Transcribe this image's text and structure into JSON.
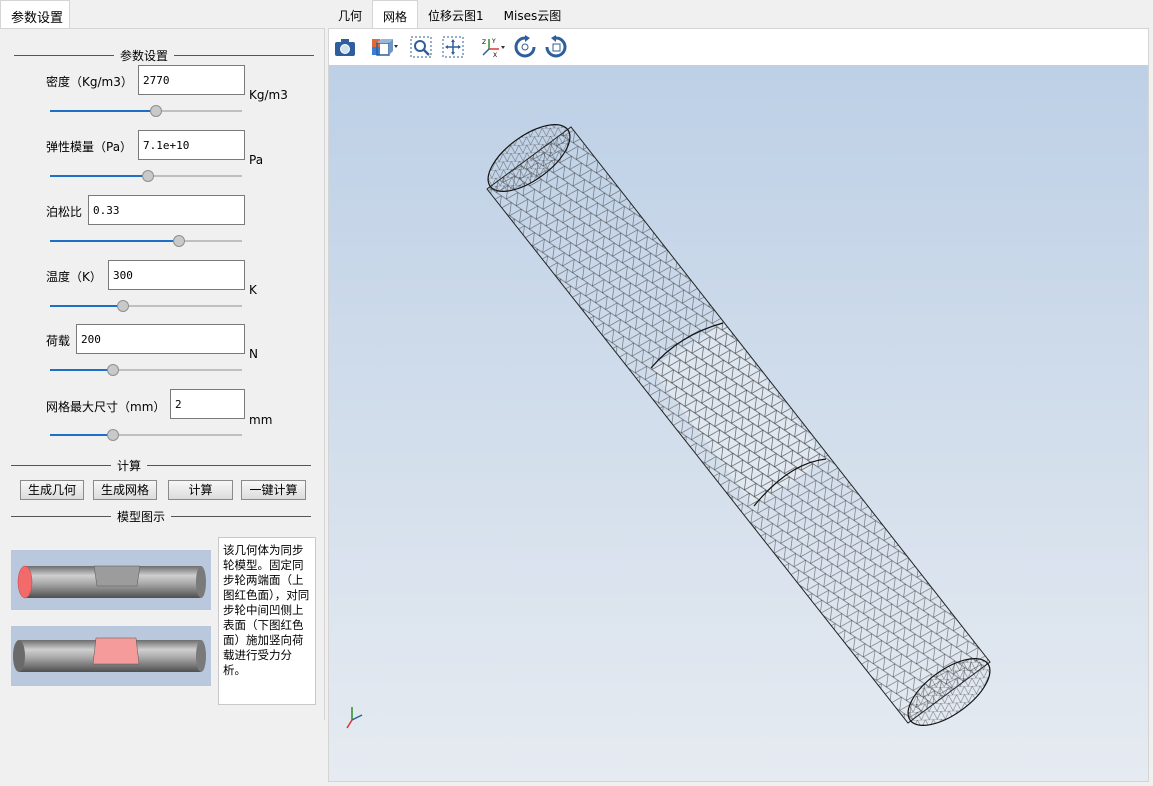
{
  "left_tab": {
    "label": "参数设置"
  },
  "params_group": {
    "title": "参数设置"
  },
  "params": [
    {
      "label": "密度（Kg/m3）",
      "value": "2770",
      "unit": "Kg/m3",
      "slider": 0.55
    },
    {
      "label": "弹性模量（Pa）",
      "value": "7.1e+10",
      "unit": "Pa",
      "slider": 0.51
    },
    {
      "label": "泊松比",
      "value": "0.33",
      "unit": "",
      "slider": 0.67
    },
    {
      "label": "温度（K）",
      "value": "300",
      "unit": "K",
      "slider": 0.38
    },
    {
      "label": "荷载",
      "value": "200",
      "unit": "N",
      "slider": 0.33
    },
    {
      "label": "网格最大尺寸（mm）",
      "value": "2",
      "unit": "mm",
      "slider": 0.33
    }
  ],
  "compute_group": {
    "title": "计算"
  },
  "buttons": {
    "gen_geometry": "生成几何",
    "gen_mesh": "生成网格",
    "compute": "计算",
    "one_click": "一键计算"
  },
  "model_group": {
    "title": "模型图示"
  },
  "description": "该几何体为同步轮模型。固定同步轮两端面（上图红色面），对同步轮中间凹侧上表面（下图红色面）施加竖向荷载进行受力分析。",
  "tabs": [
    "几何",
    "网格",
    "位移云图1",
    "Mises云图"
  ],
  "active_tab": 1,
  "toolbar_icons": [
    "camera-icon",
    "view-cube-icon",
    "zoom-fit-icon",
    "pan-icon",
    "axes-orient-icon",
    "rotate-cw-icon",
    "rotate-ccw-icon"
  ],
  "colors": {
    "accent": "#1e6fc8",
    "viewport_top": "#bdd0e6",
    "viewport_bottom": "#e6ebf1",
    "red_face": "#f26a6a"
  }
}
